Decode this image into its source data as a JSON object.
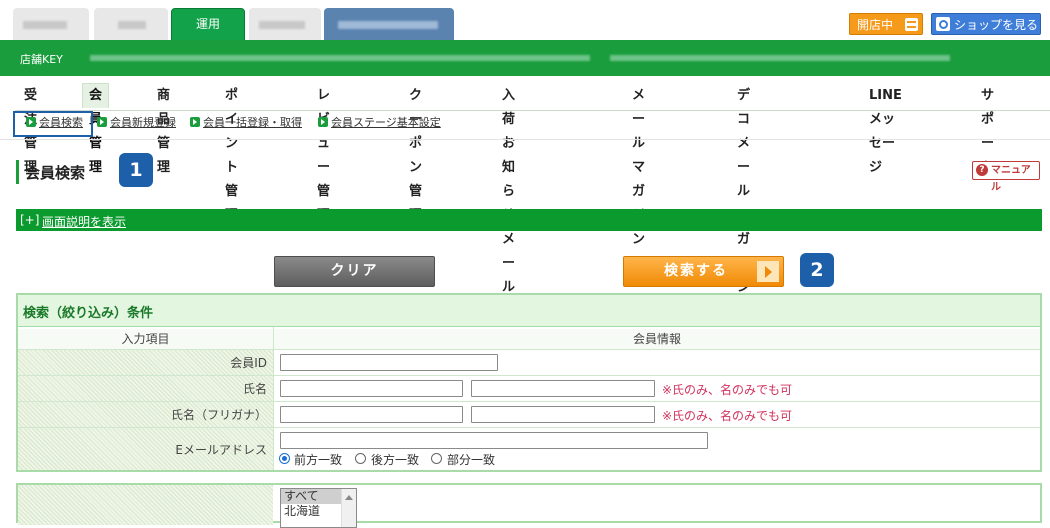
{
  "top_tabs": {
    "active_label": "運用"
  },
  "header_buttons": {
    "open_store": "開店中",
    "view_shop": "ショップを見る"
  },
  "store_bar": {
    "label": "店舗KEY"
  },
  "main_nav": [
    {
      "label": "受注管理"
    },
    {
      "label": "会員管理",
      "active": true
    },
    {
      "label": "商品管理"
    },
    {
      "label": "ポイント管理"
    },
    {
      "label": "レビュー管理"
    },
    {
      "label": "クーポン管理"
    },
    {
      "label": "入荷お知らせメール"
    },
    {
      "label": "メールマガジン"
    },
    {
      "label": "デコメールマガジン"
    },
    {
      "label": "LINEメッセージ"
    },
    {
      "label": "サポート"
    }
  ],
  "sub_nav": [
    {
      "label": "会員検索"
    },
    {
      "label": "会員新規登録"
    },
    {
      "label": "会員一括登録・取得"
    },
    {
      "label": "会員ステージ基本設定"
    }
  ],
  "page": {
    "title": "会員検索",
    "manual": "マニュアル"
  },
  "explain": {
    "toggle": "[+]",
    "link": "画面説明を表示"
  },
  "badges": {
    "one": "1",
    "two": "2"
  },
  "actions": {
    "clear": "クリア",
    "search": "検索する"
  },
  "conditions": {
    "title": "検索（絞り込み）条件",
    "col_input": "入力項目",
    "col_member": "会員情報",
    "rows": {
      "member_id": "会員ID",
      "name": "氏名",
      "name_kana": "氏名（フリガナ）",
      "email": "Eメールアドレス"
    },
    "note": "※氏のみ、名のみでも可",
    "match_options": [
      "前方一致",
      "後方一致",
      "部分一致"
    ],
    "match_selected": "前方一致"
  },
  "region_list": [
    "すべて",
    "北海道"
  ],
  "colors": {
    "brand_green": "#1a9d3c",
    "badge_blue": "#1d5fa8",
    "accent_orange": "#f59a1a"
  }
}
